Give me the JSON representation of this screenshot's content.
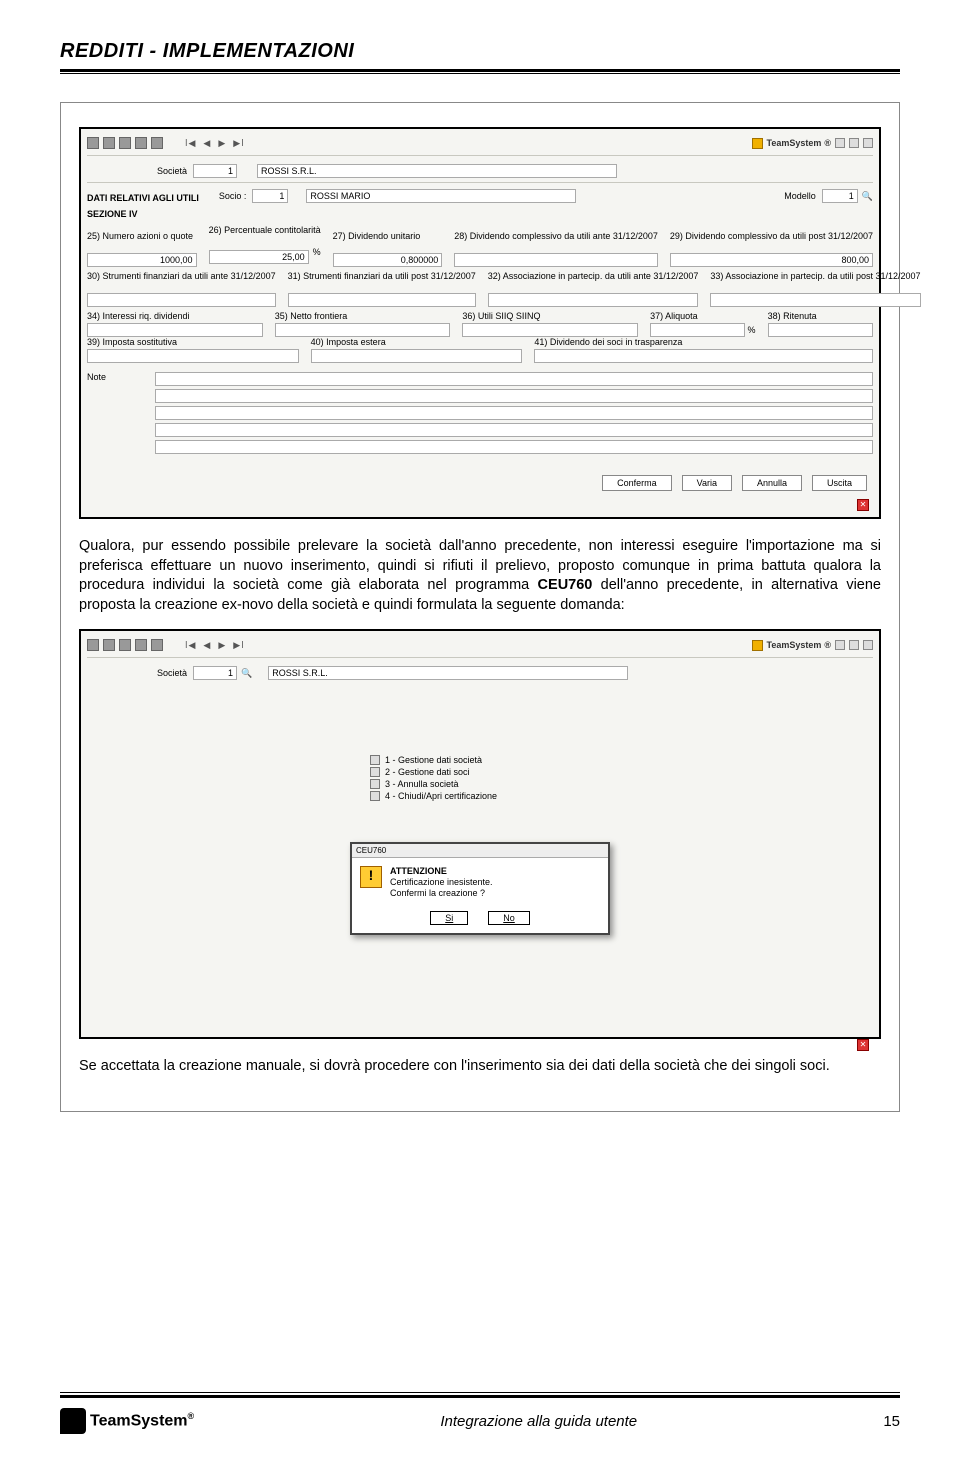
{
  "doc": {
    "title": "REDDITI - IMPLEMENTAZIONI"
  },
  "brand": "TeamSystem",
  "screenshot1": {
    "societa_label": "Società",
    "societa_code": "1",
    "societa_name": "ROSSI S.R.L.",
    "section_header_1": "DATI RELATIVI AGLI UTILI",
    "section_header_2": "SEZIONE IV",
    "socio_label": "Socio :",
    "socio_code": "1",
    "socio_name": "ROSSI MARIO",
    "modello_label": "Modello",
    "modello_value": "1",
    "c25": "25) Numero azioni o quote",
    "c26": "26) Percentuale contitolarità",
    "c27": "27) Dividendo unitario",
    "c28": "28) Dividendo complessivo da utili ante 31/12/2007",
    "c29": "29) Dividendo complessivo da utili post 31/12/2007",
    "v25": "1000,00",
    "v26": "25,00",
    "v26_suffix": "%",
    "v27": "0,800000",
    "v28": "",
    "v29": "800,00",
    "c30": "30) Strumenti finanziari da utili ante 31/12/2007",
    "c31": "31) Strumenti finanziari da utili post 31/12/2007",
    "c32": "32) Associazione in partecip. da utili ante 31/12/2007",
    "c33": "33) Associazione in partecip. da utili post 31/12/2007",
    "c34": "34) Interessi riq. dividendi",
    "c35": "35) Netto frontiera",
    "c36": "36) Utili SIIQ SIINQ",
    "c37": "37) Aliquota",
    "c37_suffix": "%",
    "c38": "38) Ritenuta",
    "c39": "39) Imposta sostitutiva",
    "c40": "40) Imposta estera",
    "c41": "41) Dividendo dei soci in trasparenza",
    "note_label": "Note",
    "btn_conferma": "Conferma",
    "btn_varia": "Varia",
    "btn_annulla": "Annulla",
    "btn_uscita": "Uscita"
  },
  "para1": "Qualora, pur essendo possibile prelevare la società dall'anno precedente, non interessi eseguire l'importazione ma si preferisca effettuare un nuovo inserimento, quindi si rifiuti il prelievo, proposto comunque in prima battuta qualora la procedura individui la società come già elaborata nel programma ",
  "para1_bold": "CEU760",
  "para1_rest": " dell'anno precedente, in alternativa viene proposta la creazione ex-novo della società e quindi formulata la seguente domanda:",
  "screenshot2": {
    "societa_label": "Società",
    "societa_code": "1",
    "societa_name": "ROSSI S.R.L.",
    "menu": [
      "1 - Gestione dati società",
      "2 - Gestione dati soci",
      "3 - Annulla società",
      "4 - Chiudi/Apri certificazione"
    ],
    "dlg_title": "CEU760",
    "dlg_head": "ATTENZIONE",
    "dlg_line1": "Certificazione inesistente.",
    "dlg_line2": "Confermi la creazione ?",
    "dlg_si": "Si",
    "dlg_no": "No"
  },
  "para2": "Se accettata la creazione manuale, si dovrà procedere con l'inserimento sia dei dati della società che dei singoli soci.",
  "footer": {
    "brand": "TeamSystem",
    "center": "Integrazione alla guida utente",
    "page": "15"
  }
}
